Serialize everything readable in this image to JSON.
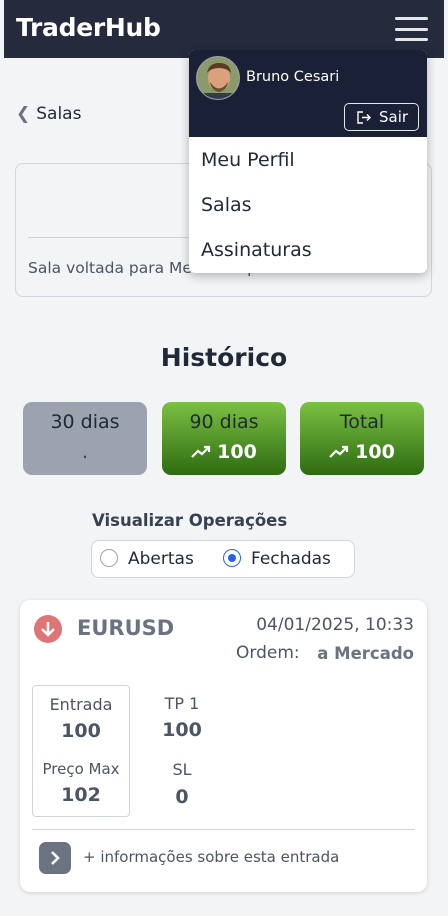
{
  "app": {
    "brand": "TraderHub"
  },
  "nav": {
    "back_label": "Salas"
  },
  "room": {
    "description": "Sala voltada para Mesas Proprietárias."
  },
  "history": {
    "title": "Histórico",
    "periods": [
      {
        "label": "30 dias",
        "value": "."
      },
      {
        "label": "90 dias",
        "value": "100"
      },
      {
        "label": "Total",
        "value": "100"
      }
    ]
  },
  "view": {
    "label": "Visualizar Operações",
    "options": [
      "Abertas",
      "Fechadas"
    ],
    "selected": "Fechadas"
  },
  "operation": {
    "symbol": "EURUSD",
    "datetime": "04/01/2025, 10:33",
    "order_label": "Ordem:",
    "order_value": "a Mercado",
    "entry_label": "Entrada",
    "entry_value": "100",
    "max_price_label": "Preço Max",
    "max_price_value": "102",
    "tp_label": "TP 1",
    "tp_value": "100",
    "sl_label": "SL",
    "sl_value": "0",
    "more_info": "+ informações sobre esta entrada",
    "direction_color": "#e07373"
  },
  "user_menu": {
    "name": "Bruno Cesari",
    "logout_label": "Sair",
    "items": [
      "Meu Perfil",
      "Salas",
      "Assinaturas"
    ]
  },
  "colors": {
    "header_bg": "#252b3d",
    "positive_green": "#2e6b12",
    "radio_accent": "#2563eb"
  }
}
